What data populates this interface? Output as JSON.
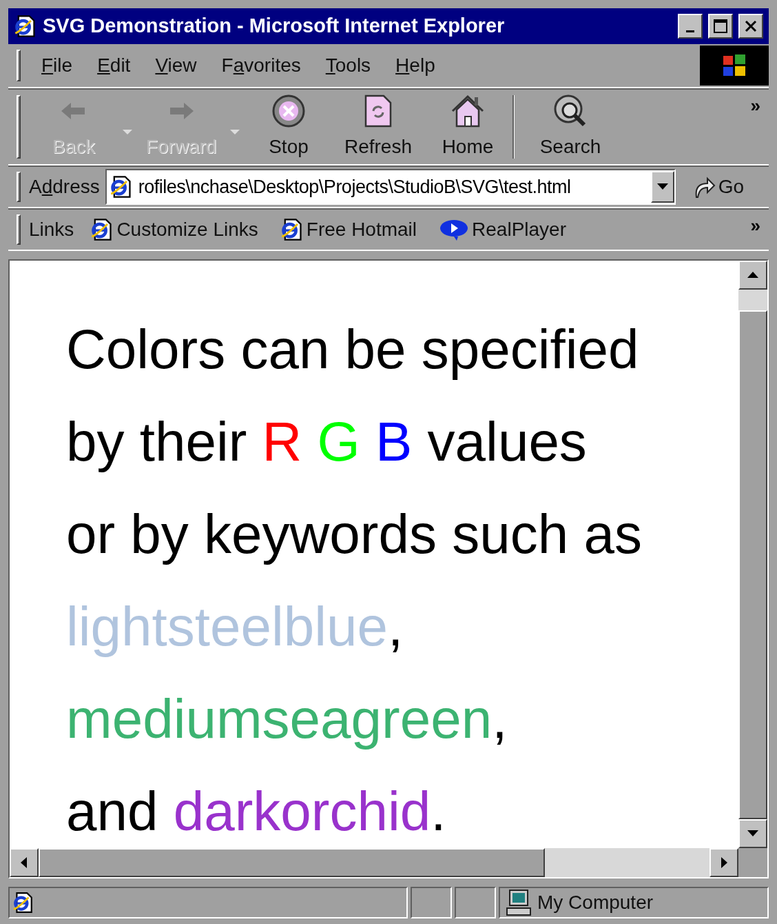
{
  "window": {
    "title": "SVG Demonstration - Microsoft Internet Explorer"
  },
  "menu": [
    {
      "key": "F",
      "post": "ile"
    },
    {
      "key": "E",
      "post": "dit"
    },
    {
      "key": "V",
      "post": "iew"
    },
    {
      "pre": "F",
      "key": "a",
      "post": "vorites"
    },
    {
      "key": "T",
      "post": "ools"
    },
    {
      "key": "H",
      "post": "elp"
    }
  ],
  "toolbar": [
    {
      "kind": "back",
      "label": "Back",
      "disabled": true,
      "dropdown": true
    },
    {
      "kind": "forward",
      "label": "Forward",
      "disabled": true,
      "dropdown": true
    },
    {
      "kind": "stop",
      "label": "Stop",
      "disabled": false,
      "dropdown": false
    },
    {
      "kind": "refresh",
      "label": "Refresh",
      "disabled": false,
      "dropdown": false
    },
    {
      "kind": "home",
      "label": "Home",
      "disabled": false,
      "dropdown": false
    },
    {
      "kind": "search",
      "label": "Search",
      "disabled": false,
      "dropdown": false
    }
  ],
  "toolbar_more": "»",
  "address": {
    "label": {
      "pre": "A",
      "key": "d",
      "post": "dress"
    },
    "value": "rofiles\\nchase\\Desktop\\Projects\\StudioB\\SVG\\test.html",
    "go": "Go"
  },
  "links": {
    "label": "Links",
    "items": [
      {
        "kind": "page",
        "label": "Customize Links"
      },
      {
        "kind": "page",
        "label": "Free Hotmail"
      },
      {
        "kind": "player",
        "label": "RealPlayer"
      }
    ],
    "more": "»"
  },
  "content": {
    "lines": [
      [
        {
          "text": "Colors can be specified",
          "color": "#000000"
        }
      ],
      [
        {
          "text": "by their ",
          "color": "#000000"
        },
        {
          "text": "R ",
          "color": "#ff0000"
        },
        {
          "text": "G ",
          "color": "#00ff00"
        },
        {
          "text": "B",
          "color": "#0000ff"
        },
        {
          "text": " values",
          "color": "#000000"
        }
      ],
      [
        {
          "text": "or by keywords such as",
          "color": "#000000"
        }
      ],
      [
        {
          "text": "lightsteelblue",
          "color": "#b0c4de"
        },
        {
          "text": ",",
          "color": "#000000"
        }
      ],
      [
        {
          "text": "mediumseagreen",
          "color": "#3cb371"
        },
        {
          "text": ",",
          "color": "#000000"
        }
      ],
      [
        {
          "text": "and ",
          "color": "#000000"
        },
        {
          "text": "darkorchid",
          "color": "#9932cc"
        },
        {
          "text": ".",
          "color": "#000000"
        }
      ]
    ]
  },
  "status_bar": {
    "zone": "My Computer"
  }
}
